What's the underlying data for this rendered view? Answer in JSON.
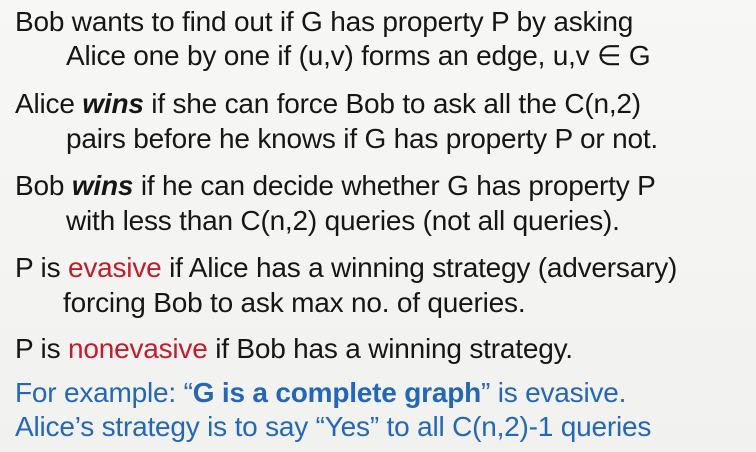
{
  "slide": {
    "p1": {
      "l1": "Bob wants to find out if G has property P by asking",
      "l2": "Alice one by one if (u,v) forms an edge, u,v ∈ G"
    },
    "p2": {
      "l1a": "Alice ",
      "l1b": "wins",
      "l1c": " if she can force Bob to ask all the C(n,2)",
      "l2": "pairs before he knows if G has property P or not."
    },
    "p3": {
      "l1a": "Bob ",
      "l1b": "wins",
      "l1c": " if he can decide whether G has property P",
      "l2": "with less than C(n,2) queries (not all queries)."
    },
    "p4": {
      "l1a": "P is ",
      "l1b": "evasive",
      "l1c": " if Alice has a winning strategy (adversary)",
      "l2": "forcing Bob to ask max no. of queries."
    },
    "p5": {
      "l1a": "P is ",
      "l1b": "nonevasive",
      "l1c": " if Bob has a winning strategy."
    },
    "example": {
      "l1a": "For example: “",
      "l1b": "G is a complete graph",
      "l1c": "” is evasive.",
      "l2": "Alice’s strategy is to say “Yes” to all C(n,2)-1 queries"
    }
  },
  "colors": {
    "text": "#161616",
    "accent_red": "#c31d2b",
    "accent_blue": "#2467b6",
    "background": "#f3f3f1"
  }
}
